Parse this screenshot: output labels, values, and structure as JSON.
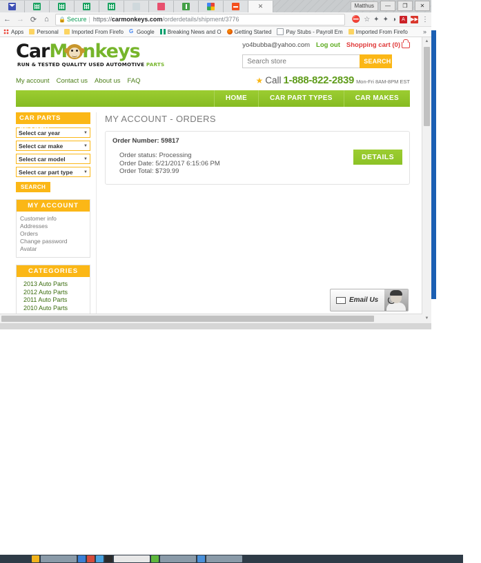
{
  "browser": {
    "window_user": "Matthus",
    "tabs": [
      {
        "icon": "mail-icon",
        "active": false
      },
      {
        "icon": "spreadsheet-icon",
        "active": false
      },
      {
        "icon": "spreadsheet-icon",
        "active": false
      },
      {
        "icon": "spreadsheet-icon",
        "active": false
      },
      {
        "icon": "spreadsheet-icon",
        "active": false
      },
      {
        "icon": "twitter-icon",
        "active": false
      },
      {
        "icon": "heart-icon",
        "active": false
      },
      {
        "icon": "alert-icon",
        "active": false
      },
      {
        "icon": "chrome-icon",
        "active": false
      },
      {
        "icon": "orange-circle-icon",
        "active": false
      },
      {
        "icon": "close-icon",
        "active": true
      }
    ],
    "window_controls": {
      "minimize": "—",
      "maximize": "❐",
      "close": "✕"
    },
    "nav": {
      "back": "←",
      "forward": "→",
      "reload": "⟳",
      "home": "⌂"
    },
    "omnibox": {
      "secure_label": "Secure",
      "scheme": "https://",
      "host": "carmonkeys.com",
      "path": "/orderdetails/shipment/3776",
      "full_url": "https://carmonkeys.com/orderdetails/shipment/3776"
    },
    "omnibox_actions": [
      {
        "name": "blocked-popup-icon",
        "glyph": "⛔"
      },
      {
        "name": "bookmark-star-icon",
        "glyph": "☆"
      },
      {
        "name": "extension-puzzle-icon",
        "glyph": "✦"
      },
      {
        "name": "extension-puzzle-2-icon",
        "glyph": "✦"
      },
      {
        "name": "flame-icon",
        "glyph": "◑"
      },
      {
        "name": "pdf-extension-icon",
        "glyph": "A"
      },
      {
        "name": "red-extension-icon",
        "glyph": "▶▶"
      },
      {
        "name": "chrome-menu-icon",
        "glyph": "⋮"
      }
    ],
    "bookmarks": [
      {
        "label": "Apps",
        "icon": "apps-grid-icon"
      },
      {
        "label": "Personal",
        "icon": "folder-icon"
      },
      {
        "label": "Imported From Firefo",
        "icon": "folder-icon"
      },
      {
        "label": "Google",
        "icon": "google-g-icon"
      },
      {
        "label": "Breaking News and O",
        "icon": "news-icon"
      },
      {
        "label": "Getting Started",
        "icon": "firefox-icon"
      },
      {
        "label": "Pay Stubs - Payroll Em",
        "icon": "document-icon"
      },
      {
        "label": "Imported From Firefo",
        "icon": "folder-icon"
      }
    ],
    "bookmarks_overflow": "»"
  },
  "site": {
    "logo": {
      "text_part_1": "Car",
      "text_part_2": "M",
      "text_part_3": "nkeys",
      "tagline_1": "RUN & TESTED QUALITY USED AUTOMOTIVE",
      "tagline_2": "PARTS"
    },
    "header": {
      "user_email": "yo4bubba@yahoo.com",
      "logout_label": "Log out",
      "cart_label": "Shopping cart (0)",
      "search_placeholder": "Search store",
      "search_button": "SEARCH"
    },
    "top_links": [
      "My account",
      "Contact us",
      "About us",
      "FAQ"
    ],
    "phone": {
      "star": "★",
      "call_label": "Call",
      "number": "1-888-822-2839",
      "hours": "Mon-Fri 8AM-8PM EST"
    },
    "main_menu": [
      "HOME",
      "CAR PART TYPES",
      "CAR MAKES"
    ],
    "sidebar": {
      "car_parts_search": {
        "title": "CAR PARTS SEARCH",
        "selects": [
          {
            "value": "Select car year"
          },
          {
            "value": "Select car make"
          },
          {
            "value": "Select car model"
          },
          {
            "value": "Select car part type"
          }
        ],
        "button": "SEARCH"
      },
      "my_account": {
        "title": "MY ACCOUNT",
        "items": [
          "Customer info",
          "Addresses",
          "Orders",
          "Change password",
          "Avatar"
        ]
      },
      "categories": {
        "title": "CATEGORIES",
        "items": [
          "2013 Auto Parts",
          "2012 Auto Parts",
          "2011 Auto Parts",
          "2010 Auto Parts"
        ]
      }
    },
    "main": {
      "page_title": "MY ACCOUNT - ORDERS",
      "order": {
        "number_label": "Order Number: 59817",
        "status": "Order status: Processing",
        "date": "Order Date: 5/21/2017 6:15:06 PM",
        "total": "Order Total: $739.99",
        "details_button": "DETAILS"
      }
    },
    "email_widget": {
      "label": "Email Us",
      "icon": "envelope-icon"
    }
  },
  "colors": {
    "brand_green": "#76b52b",
    "menu_green": "#9ccd31",
    "accent_orange": "#fbb716",
    "cart_red": "#e03a3a",
    "secure_green": "#0f9d58",
    "taskbar": "#2f3b47",
    "desktop_blue": "#1b5fb3"
  }
}
